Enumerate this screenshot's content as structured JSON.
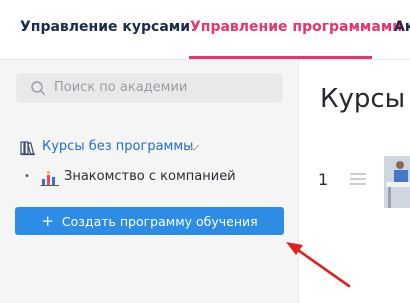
{
  "nav": {
    "tabs": [
      {
        "label": "Управление курсами"
      },
      {
        "label": "Управление программами"
      },
      {
        "label": "Ак"
      }
    ],
    "active_color": "#e8336b"
  },
  "sidebar": {
    "search": {
      "placeholder": "Поиск по академии",
      "icon": "search-icon"
    },
    "folder": {
      "label": "Курсы без программы",
      "icon": "books-icon"
    },
    "course": {
      "label": "Знакомство с компанией",
      "icon": "chart-icon"
    },
    "create_button": {
      "label": "Создать программу обучения",
      "icon": "plus-icon"
    }
  },
  "main": {
    "title": "Курсы",
    "row": {
      "number": "1"
    }
  },
  "colors": {
    "accent": "#2d8ce6",
    "link": "#1f6fd1",
    "annotation": "#e02020"
  }
}
